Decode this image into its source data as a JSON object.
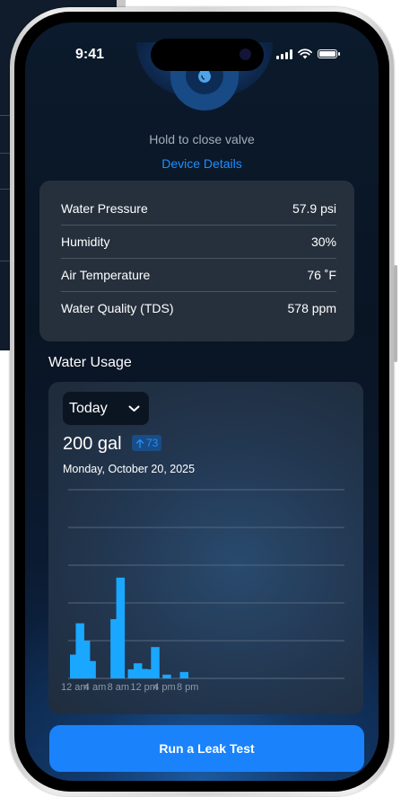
{
  "status_bar": {
    "time": "9:41"
  },
  "valve": {
    "icon": "water-drop-icon",
    "hint": "Hold to close valve",
    "details_link": "Device Details"
  },
  "metrics": [
    {
      "label": "Water Pressure",
      "value": "57.9 psi"
    },
    {
      "label": "Humidity",
      "value": "30%"
    },
    {
      "label": "Air Temperature",
      "value": "76 ˚F"
    },
    {
      "label": "Water Quality (TDS)",
      "value": "578 ppm"
    }
  ],
  "usage": {
    "title": "Water Usage",
    "period": "Today",
    "total": "200 gal",
    "delta": "73",
    "date": "Monday, October 20, 2025"
  },
  "chart_data": {
    "type": "bar",
    "x_tick_labels": [
      "12 am",
      "4 am",
      "8 am",
      "12 pm",
      "4 pm",
      "8 pm"
    ],
    "hours": [
      0,
      1,
      2,
      3,
      4,
      5,
      6,
      7,
      8,
      9,
      10,
      11,
      12,
      13,
      14,
      15,
      16,
      17,
      18,
      19,
      20,
      21,
      22,
      23
    ],
    "values": [
      0.63,
      1.46,
      1.0,
      0.46,
      0,
      0,
      0,
      1.57,
      2.67,
      0,
      0.24,
      0.4,
      0.25,
      0.24,
      0.83,
      0,
      0.1,
      0,
      0,
      0.17,
      0,
      0,
      0,
      0
    ],
    "ylim": [
      0,
      5
    ],
    "grid": true,
    "bar_color": "#1aa7ff"
  },
  "cta": {
    "label": "Run a Leak Test"
  },
  "colors": {
    "accent": "#1a82fb",
    "link": "#1f8fff"
  }
}
